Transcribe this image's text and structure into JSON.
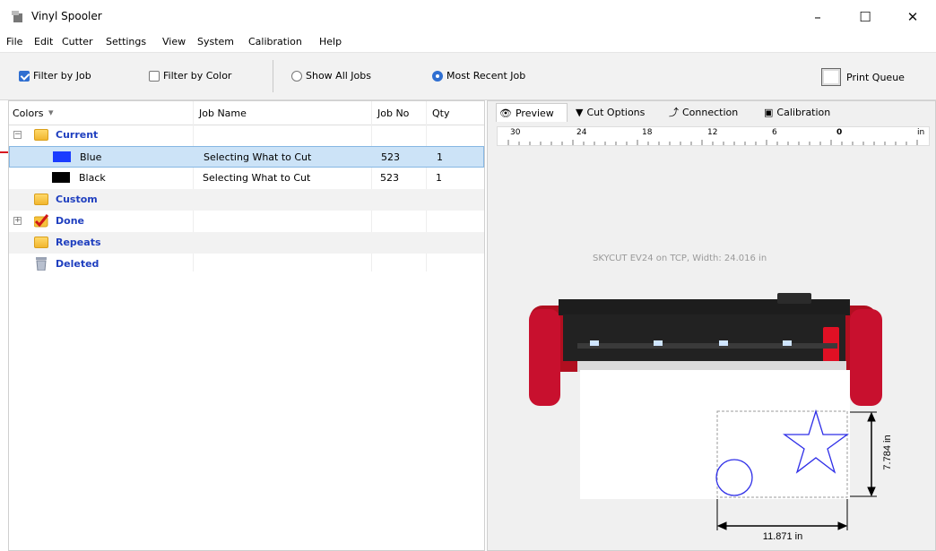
{
  "window": {
    "title": "Vinyl Spooler",
    "minimize": "–",
    "maximize": "☐",
    "close": "✕"
  },
  "menu": [
    "File",
    "Edit",
    "Cutter",
    "Settings",
    "View",
    "System",
    "Calibration",
    "Help"
  ],
  "toolbar": {
    "filter_by_job": {
      "label": "Filter by Job",
      "checked": true
    },
    "filter_by_color": {
      "label": "Filter by Color",
      "checked": false
    },
    "show_all_jobs": {
      "label": "Show All Jobs",
      "selected": false
    },
    "most_recent_job": {
      "label": "Most Recent Job",
      "selected": true
    },
    "print_queue": "Print Queue"
  },
  "tree": {
    "headers": {
      "colors": "Colors",
      "job_name": "Job Name",
      "job_no": "Job No",
      "qty": "Qty"
    },
    "rows": [
      {
        "label": "Current",
        "expander": "−",
        "type": "folder"
      },
      {
        "label": "Blue",
        "job_name": "Selecting What to Cut",
        "job_no": "523",
        "qty": "1",
        "color": "#1a3cff",
        "selected": true
      },
      {
        "label": "Black",
        "job_name": "Selecting What to Cut",
        "job_no": "523",
        "qty": "1",
        "color": "#000000"
      },
      {
        "label": "Custom",
        "type": "folder"
      },
      {
        "label": "Done",
        "expander": "+",
        "type": "done"
      },
      {
        "label": "Repeats",
        "type": "folder"
      },
      {
        "label": "Deleted",
        "type": "trash"
      }
    ]
  },
  "tabs": [
    "Preview",
    "Cut Options",
    "Connection",
    "Calibration"
  ],
  "ruler": {
    "labels": [
      "30",
      "24",
      "18",
      "12",
      "6",
      "0",
      "in"
    ]
  },
  "preview": {
    "status": "SKYCUT EV24 on TCP,  Width: 24.016 in",
    "height_dim": "7.784 in",
    "width_dim": "11.871 in"
  },
  "colors": {
    "accent": "#2f6fd1",
    "selection": "#cce3f7",
    "tree_label": "#1f3fbf",
    "cutter_red": "#c8102e"
  }
}
